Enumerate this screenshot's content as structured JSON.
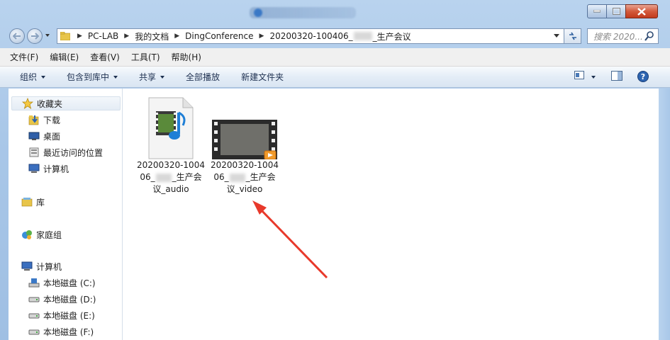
{
  "window": {
    "controls": {
      "minimize": "minimize",
      "maximize": "maximize",
      "close": "close"
    }
  },
  "address": {
    "root_icon": "folder-icon",
    "crumbs": [
      "PC-LAB",
      "我的文档",
      "DingConference"
    ],
    "current_prefix": "20200320-100406_",
    "current_suffix": "_生产会议",
    "search_placeholder": "搜索 2020..."
  },
  "menu": [
    "文件(F)",
    "编辑(E)",
    "查看(V)",
    "工具(T)",
    "帮助(H)"
  ],
  "commands": [
    {
      "label": "组织",
      "dropdown": true
    },
    {
      "label": "包含到库中",
      "dropdown": true
    },
    {
      "label": "共享",
      "dropdown": true
    },
    {
      "label": "全部播放",
      "dropdown": false
    },
    {
      "label": "新建文件夹",
      "dropdown": false
    }
  ],
  "nav": {
    "favorites": {
      "label": "收藏夹",
      "items": [
        "下载",
        "桌面",
        "最近访问的位置",
        "计算机"
      ]
    },
    "library": "库",
    "homegroup": "家庭组",
    "computer": {
      "label": "计算机",
      "drives": [
        "本地磁盘 (C:)",
        "本地磁盘 (D:)",
        "本地磁盘 (E:)",
        "本地磁盘 (F:)"
      ]
    }
  },
  "files": [
    {
      "line1": "20200320-1004",
      "line2_prefix": "06_",
      "line2_suffix": "_生产会",
      "line3": "议_audio",
      "type": "audio"
    },
    {
      "line1": "20200320-1004",
      "line2_prefix": "06_",
      "line2_suffix": "_生产会",
      "line3": "议_video",
      "type": "video"
    }
  ],
  "colors": {
    "annotation_arrow": "#e8392b",
    "accent": "#3a78c6"
  }
}
